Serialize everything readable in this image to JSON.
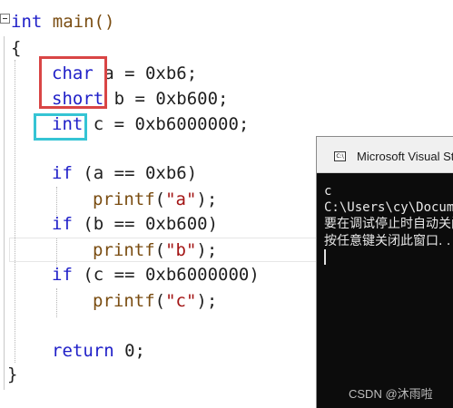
{
  "editor": {
    "lines": {
      "l1_kw": "int",
      "l1_rest": " main()",
      "l2": "{",
      "l3_kw": "char",
      "l3_rest": " a = 0xb6;",
      "l4_kw": "short",
      "l4_rest": " b = 0xb600;",
      "l5_kw": "int",
      "l5_rest": " c = 0xb6000000;",
      "l6_kw": "if",
      "l6_rest": " (a == 0xb6)",
      "l7_fn": "printf",
      "l7_open": "(",
      "l7_str": "\"a\"",
      "l7_close": ");",
      "l8_kw": "if",
      "l8_rest": " (b == 0xb600)",
      "l9_fn": "printf",
      "l9_open": "(",
      "l9_str": "\"b\"",
      "l9_close": ");",
      "l10_kw": "if",
      "l10_rest": " (c == 0xb6000000)",
      "l11_fn": "printf",
      "l11_open": "(",
      "l11_str": "\"c\"",
      "l11_close": ");",
      "l12_kw": "return",
      "l12_rest": " 0;",
      "l13": "}"
    }
  },
  "console": {
    "title": "Microsoft Visual Studio Debug Console",
    "icon_label": "C:\\",
    "output": [
      "c",
      "C:\\Users\\cy\\Documents",
      "要在调试停止时自动关闭控制台",
      "按任意键关闭此窗口. . ."
    ]
  },
  "watermark": "CSDN @沐雨啦",
  "colors": {
    "keyword": "#2020c8",
    "function": "#7a4d12",
    "string": "#a31515",
    "highlight_red": "#d94545",
    "highlight_cyan": "#35c4d4",
    "console_bg": "#0c0c0c"
  }
}
